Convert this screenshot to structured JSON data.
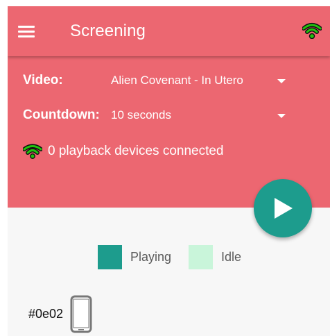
{
  "header": {
    "title": "Screening"
  },
  "controls": {
    "video_label": "Video:",
    "video_value": "Alien Covenant - In Utero",
    "countdown_label": "Countdown:",
    "countdown_value": "10 seconds",
    "devices_status": "0 playback devices connected"
  },
  "legend": {
    "playing_label": "Playing",
    "idle_label": "Idle",
    "playing_color": "#1d9c8d",
    "idle_color": "#c9f5da"
  },
  "device_list": [
    {
      "id": "#0e02",
      "icon": "phone-icon"
    }
  ],
  "colors": {
    "accent": "#ec6771",
    "connection_green": "#22c40f",
    "fab": "#1d9c8d"
  }
}
